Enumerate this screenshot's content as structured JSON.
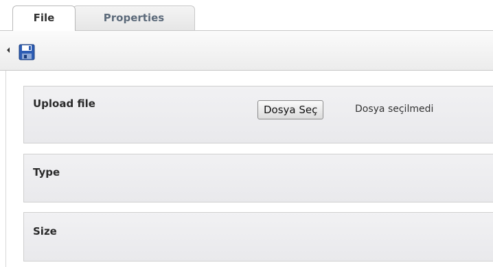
{
  "tabs": [
    {
      "label": "File",
      "active": true
    },
    {
      "label": "Properties",
      "active": false
    }
  ],
  "toolbar": {
    "collapse_icon": "triangle-left-icon",
    "save_icon": "floppy-disk-icon"
  },
  "fields": {
    "upload": {
      "label": "Upload file",
      "button_label": "Dosya Seç",
      "status_text": "Dosya seçilmedi"
    },
    "type": {
      "label": "Type"
    },
    "size": {
      "label": "Size"
    }
  },
  "colors": {
    "save_icon_blue": "#2d5db4",
    "panel_bg": "#eeeef1",
    "border": "#cfcfcf"
  }
}
